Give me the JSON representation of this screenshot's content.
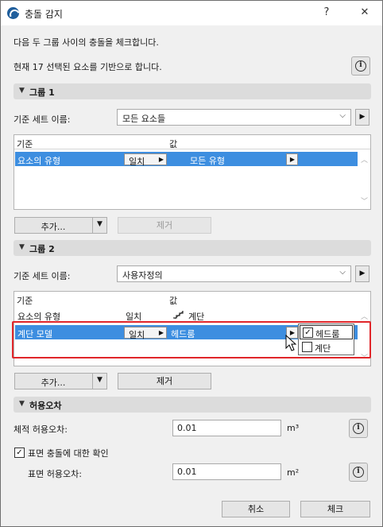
{
  "window": {
    "title": "충돌 감지",
    "help_glyph": "?",
    "close_glyph": "✕"
  },
  "intro": {
    "line1": "다음 두 그룹 사이의 충돌을 체크합니다.",
    "line2": "현재 17 선택된 요소를 기반으로 합니다."
  },
  "group1": {
    "header": "그룹 1",
    "set_label": "기준 세트 이름:",
    "set_value": "모든 요소들",
    "col_criterion": "기준",
    "col_value": "값",
    "rows": [
      {
        "criterion": "요소의 유형",
        "operator": "일치",
        "value": "모든 유형",
        "selected": true
      }
    ],
    "add_button": "추가...",
    "remove_button": "제거"
  },
  "group2": {
    "header": "그룹 2",
    "set_label": "기준 세트 이름:",
    "set_value": "사용자정의",
    "col_criterion": "기준",
    "col_value": "값",
    "rows": [
      {
        "criterion": "요소의 유형",
        "operator": "일치",
        "value": "계단",
        "selected": false
      },
      {
        "criterion": "계단 모델",
        "operator": "일치",
        "value": "헤드룸",
        "selected": true
      }
    ],
    "popup_options": [
      {
        "label": "헤드룸",
        "checked": true
      },
      {
        "label": "계단",
        "checked": false
      }
    ],
    "add_button": "추가...",
    "remove_button": "제거"
  },
  "tolerance": {
    "header": "허용오차",
    "volume_label": "체적 허용오차:",
    "volume_value": "0.01",
    "volume_unit": "m³",
    "surface_check_label": "표면 충돌에 대한 확인",
    "surface_check_checked": true,
    "surface_label": "표면 허용오차:",
    "surface_value": "0.01",
    "surface_unit": "m²"
  },
  "footer": {
    "cancel": "취소",
    "check": "체크"
  },
  "icons": {
    "info": "i",
    "dropdown": "⌵",
    "right_arrow": "▶",
    "collapse": "▼",
    "scroll_up": "︿",
    "scroll_down": "﹀",
    "checkmark": "✓"
  }
}
